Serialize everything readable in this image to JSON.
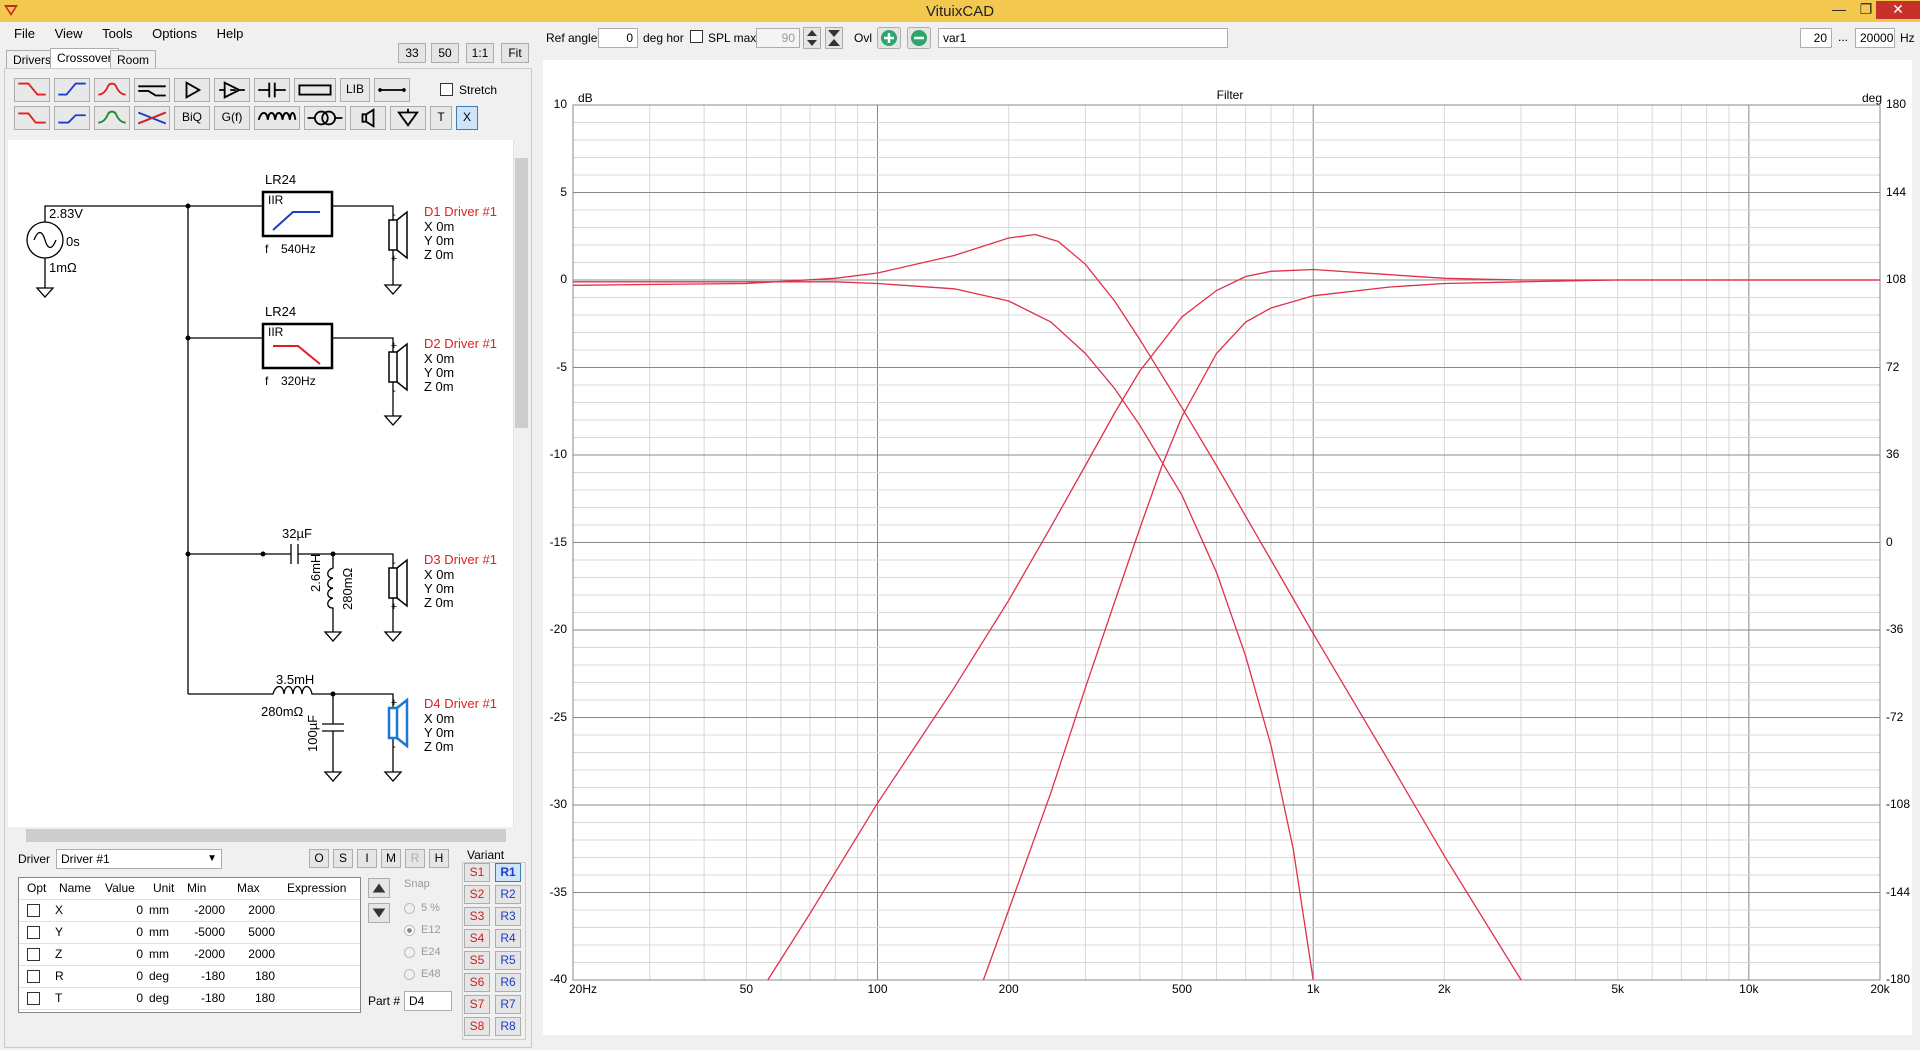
{
  "window": {
    "title": "VituixCAD",
    "minimize": "—",
    "restore": "❐",
    "close": "✕"
  },
  "menu": [
    "File",
    "View",
    "Tools",
    "Options",
    "Help"
  ],
  "tabs": [
    "Drivers",
    "Crossover",
    "Room"
  ],
  "zoom_buttons": [
    "33",
    "50",
    "1:1",
    "Fit"
  ],
  "toolbar": {
    "row1": [
      "highpass1-icon",
      "highpass2-icon",
      "bandpass-icon",
      "shelf-icon",
      "buffer-icon",
      "delay-icon",
      "capacitor-icon",
      "resistor-icon",
      "LIB",
      "connector-icon"
    ],
    "row2": [
      "lowpass1-icon",
      "lowpass2-icon",
      "bandpass2-icon",
      "allpass-icon",
      "BiQ",
      "G(f)",
      "inductor-icon",
      "transformer-icon",
      "speaker-icon",
      "ground-icon",
      "T",
      "X"
    ],
    "stretch_label": "Stretch"
  },
  "schematic": {
    "source": {
      "voltage": "2.83V",
      "delay": "0s",
      "resistance": "1mΩ"
    },
    "branches": [
      {
        "block_title": "LR24",
        "block_type": "IIR",
        "freq": "540Hz",
        "driver": "D1 Driver #1",
        "x": "X 0m",
        "y": "Y 0m",
        "z": "Z 0m"
      },
      {
        "block_title": "LR24",
        "block_type": "IIR",
        "freq": "320Hz",
        "driver": "D2 Driver #1",
        "x": "X 0m",
        "y": "Y 0m",
        "z": "Z 0m"
      },
      {
        "cap": "32µF",
        "ind": "2.6mH",
        "res": "280mΩ",
        "driver": "D3 Driver #1",
        "x": "X 0m",
        "y": "Y 0m",
        "z": "Z 0m"
      },
      {
        "ind": "3.5mH",
        "res": "280mΩ",
        "cap": "100µF",
        "driver": "D4 Driver #1",
        "x": "X 0m",
        "y": "Y 0m",
        "z": "Z 0m"
      }
    ]
  },
  "driver_panel": {
    "label": "Driver",
    "selected": "Driver #1",
    "mode_buttons": [
      "O",
      "S",
      "I",
      "M",
      "R",
      "H"
    ],
    "headers": [
      "Opt",
      "Name",
      "Value",
      "Unit",
      "Min",
      "Max",
      "Expression"
    ],
    "rows": [
      {
        "name": "X",
        "value": "0",
        "unit": "mm",
        "min": "-2000",
        "max": "2000"
      },
      {
        "name": "Y",
        "value": "0",
        "unit": "mm",
        "min": "-5000",
        "max": "5000"
      },
      {
        "name": "Z",
        "value": "0",
        "unit": "mm",
        "min": "-2000",
        "max": "2000"
      },
      {
        "name": "R",
        "value": "0",
        "unit": "deg",
        "min": "-180",
        "max": "180"
      },
      {
        "name": "T",
        "value": "0",
        "unit": "deg",
        "min": "-180",
        "max": "180"
      }
    ],
    "snap_label": "Snap",
    "snap_options": [
      "5 %",
      "E12",
      "E24",
      "E48"
    ],
    "part_label": "Part #",
    "part_value": "D4",
    "variant_label": "Variant",
    "variants_s": [
      "S1",
      "S2",
      "S3",
      "S4",
      "S5",
      "S6",
      "S7",
      "S8"
    ],
    "variants_r": [
      "R1",
      "R2",
      "R3",
      "R4",
      "R5",
      "R6",
      "R7",
      "R8"
    ]
  },
  "plot_toolbar": {
    "ref_angle_label": "Ref angle",
    "ref_angle_value": "0",
    "deg_hor_label": "deg hor",
    "spl_max_label": "SPL max",
    "spl_max_value": "90",
    "ovl_label": "Ovl",
    "variant_name": "var1",
    "fmin": "20",
    "ellipsis": "...",
    "fmax": "20000",
    "hz": "Hz"
  },
  "chart_data": {
    "type": "line",
    "title": "Filter",
    "ylabel": "dB",
    "y2label": "deg",
    "xscale": "log",
    "xlim": [
      20,
      20000
    ],
    "ylim": [
      -40,
      10
    ],
    "y2lim": [
      -180,
      180
    ],
    "x_ticks": [
      "20Hz",
      "50",
      "100",
      "200",
      "500",
      "1k",
      "2k",
      "5k",
      "10k",
      "20k"
    ],
    "y_ticks": [
      "10",
      "5",
      "0",
      "-5",
      "-10",
      "-15",
      "-20",
      "-25",
      "-30",
      "-35",
      "-40"
    ],
    "y2_ticks": [
      "180",
      "144",
      "108",
      "72",
      "36",
      "0",
      "-36",
      "-72",
      "-108",
      "-144",
      "-180"
    ],
    "grid": true,
    "line_color": "#e0304a",
    "series": [
      {
        "x": [
          20,
          50,
          80,
          100,
          150,
          200,
          230,
          260,
          300,
          350,
          400,
          500,
          600,
          700,
          800,
          1000,
          1500,
          2000,
          3000
        ],
        "y": [
          -0.3,
          -0.2,
          0.1,
          0.4,
          1.4,
          2.4,
          2.6,
          2.2,
          0.9,
          -1.2,
          -3.4,
          -7.3,
          -10.6,
          -13.5,
          -16,
          -20.2,
          -27.6,
          -32.9,
          -40
        ]
      },
      {
        "x": [
          20,
          50,
          80,
          100,
          150,
          200,
          250,
          300,
          350,
          400,
          500,
          600,
          700,
          800,
          900,
          1000
        ],
        "y": [
          -0.1,
          -0.1,
          -0.1,
          -0.2,
          -0.5,
          -1.2,
          -2.4,
          -4.2,
          -6.2,
          -8.3,
          -12.3,
          -16.7,
          -21.5,
          -26.6,
          -32.5,
          -40
        ]
      },
      {
        "x": [
          56,
          70,
          100,
          150,
          200,
          250,
          300,
          350,
          400,
          500,
          600,
          700,
          800,
          1000,
          1500,
          2000,
          3000,
          5000,
          20000
        ],
        "y": [
          -40,
          -36.2,
          -29.9,
          -23.3,
          -18.3,
          -14.1,
          -10.6,
          -7.6,
          -5.2,
          -2.1,
          -0.6,
          0.2,
          0.5,
          0.6,
          0.3,
          0.1,
          0,
          0,
          0
        ]
      },
      {
        "x": [
          175,
          200,
          250,
          300,
          350,
          400,
          450,
          500,
          600,
          700,
          800,
          1000,
          1500,
          2000,
          3000,
          5000,
          20000
        ],
        "y": [
          -40,
          -36,
          -29.3,
          -23.3,
          -18.4,
          -14.2,
          -10.6,
          -7.8,
          -4.2,
          -2.4,
          -1.6,
          -0.9,
          -0.4,
          -0.2,
          -0.1,
          0,
          0
        ]
      }
    ]
  }
}
